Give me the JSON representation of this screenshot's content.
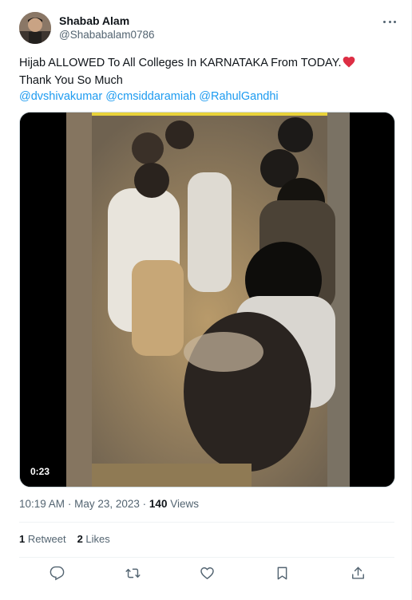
{
  "author": {
    "name": "Shabab Alam",
    "handle": "@Shababalam0786"
  },
  "tweet": {
    "line1": "Hijab ALLOWED To All Colleges In KARNATAKA From TODAY.",
    "line2": "Thank You So Much",
    "mentions": [
      "@dvshivakumar",
      "@cmsiddaramiah",
      "@RahulGandhi"
    ]
  },
  "video": {
    "duration": "0:23"
  },
  "meta": {
    "time": "10:19 AM",
    "separator": "·",
    "date": "May 23, 2023",
    "views_count": "140",
    "views_label": "Views"
  },
  "stats": {
    "retweets_count": "1",
    "retweets_label": "Retweet",
    "likes_count": "2",
    "likes_label": "Likes"
  },
  "icons": [
    "more-icon",
    "heart-emoji-icon",
    "reply-icon",
    "retweet-icon",
    "like-icon",
    "bookmark-icon",
    "share-icon"
  ],
  "colors": {
    "link": "#1d9bf0",
    "heart": "#f4212e",
    "muted": "#536471"
  }
}
